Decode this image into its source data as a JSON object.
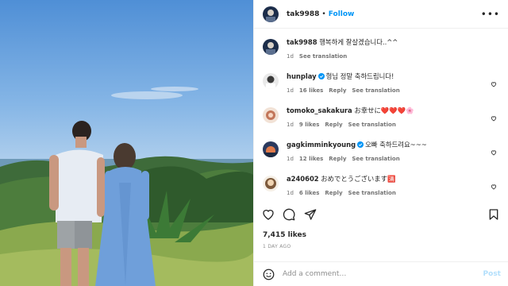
{
  "post": {
    "author": "tak9988",
    "follow_label": "Follow",
    "caption": {
      "username": "tak9988",
      "text": "행복하게 잘살겠습니다..^^",
      "age": "1d",
      "see_translation": "See translation"
    },
    "comments": [
      {
        "username": "hunplay",
        "verified": true,
        "text": "형님 정말 축하드립니다!",
        "age": "1d",
        "likes": "16 likes",
        "reply": "Reply",
        "see_translation": "See translation"
      },
      {
        "username": "tomoko_sakakura",
        "verified": false,
        "text": "お幸せに❤️❤️❤️🌸",
        "age": "1d",
        "likes": "9 likes",
        "reply": "Reply",
        "see_translation": "See translation"
      },
      {
        "username": "gagkimminkyoung",
        "verified": true,
        "text": "오빠 축하드려요~~~",
        "age": "1d",
        "likes": "12 likes",
        "reply": "Reply",
        "see_translation": "See translation"
      },
      {
        "username": "a240602",
        "verified": false,
        "text": "おめでとうございます🈵",
        "age": "1d",
        "likes": "6 likes",
        "reply": "Reply",
        "see_translation": "See translation"
      }
    ],
    "likes_count": "7,415 likes",
    "date_label": "1 DAY AGO",
    "add_comment_placeholder": "Add a comment…",
    "post_button": "Post"
  },
  "colors": {
    "accent": "#0095f6",
    "verified": "#0095f6",
    "post_disabled": "#b2dffc"
  }
}
